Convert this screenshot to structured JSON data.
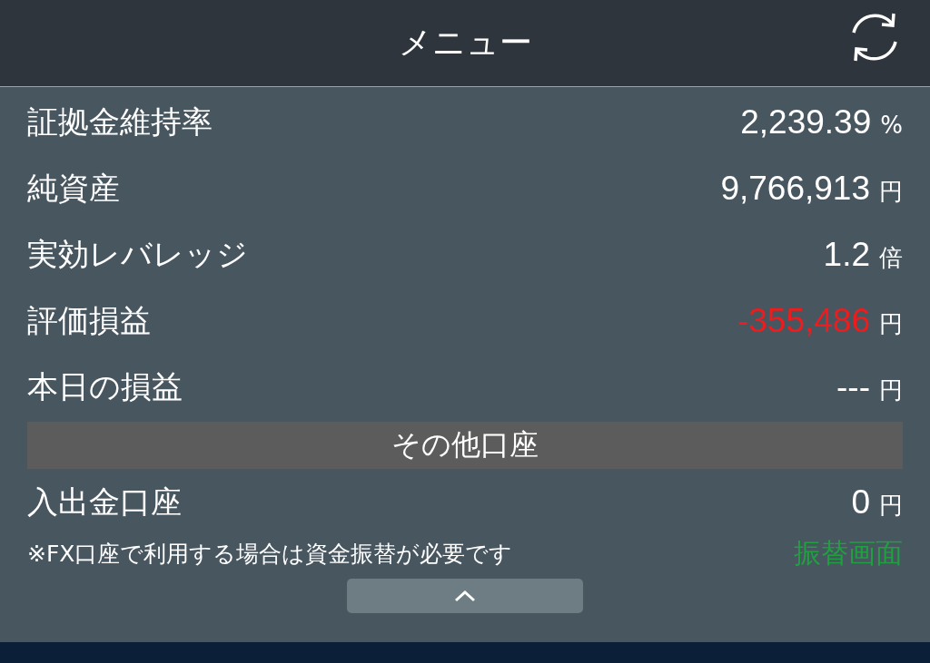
{
  "header": {
    "title": "メニュー"
  },
  "rows": [
    {
      "label": "証拠金維持率",
      "value": "2,239.39",
      "unit": "%",
      "negative": false
    },
    {
      "label": "純資産",
      "value": "9,766,913",
      "unit": "円",
      "negative": false
    },
    {
      "label": "実効レバレッジ",
      "value": "1.2",
      "unit": "倍",
      "negative": false
    },
    {
      "label": "評価損益",
      "value": "-355,486",
      "unit": "円",
      "negative": true
    },
    {
      "label": "本日の損益",
      "value": "---",
      "unit": "円",
      "negative": false
    }
  ],
  "section": {
    "title": "その他口座"
  },
  "other_rows": [
    {
      "label": "入出金口座",
      "value": "0",
      "unit": "円",
      "negative": false
    }
  ],
  "note": {
    "text": "※FX口座で利用する場合は資金振替が必要です",
    "link": "振替画面"
  }
}
